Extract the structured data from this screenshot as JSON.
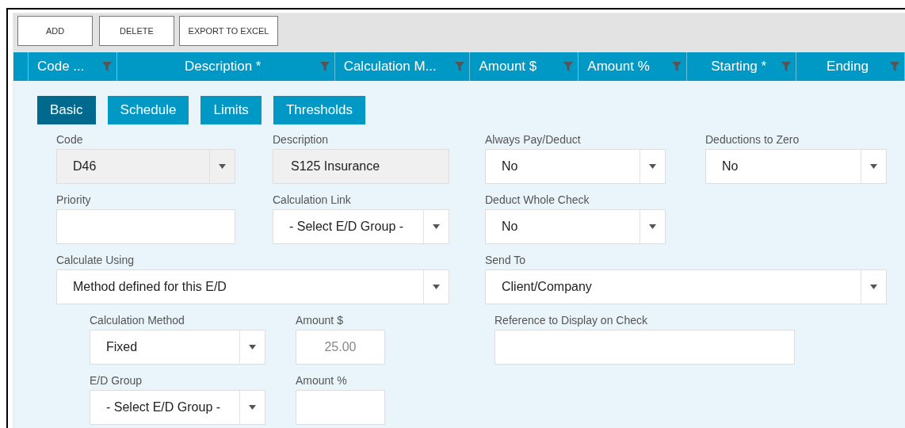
{
  "toolbar": {
    "buttons": [
      "ADD",
      "DELETE",
      "EXPORT TO EXCEL"
    ]
  },
  "table": {
    "columns": [
      {
        "label": "Code ..."
      },
      {
        "label": "Description *"
      },
      {
        "label": "Calculation M..."
      },
      {
        "label": "Amount $"
      },
      {
        "label": "Amount %"
      },
      {
        "label": "Starting *"
      },
      {
        "label": "Ending"
      }
    ]
  },
  "tabs": [
    {
      "label": "Basic",
      "selected": true
    },
    {
      "label": "Schedule",
      "selected": false
    },
    {
      "label": "Limits",
      "selected": false
    },
    {
      "label": "Thresholds",
      "selected": false
    }
  ],
  "form": {
    "left": [
      [
        {
          "label": "Code",
          "kind": "select",
          "value": "D46",
          "disabled": true
        },
        {
          "label": "Description",
          "kind": "text",
          "value": "S125 Insurance",
          "disabled": true
        }
      ],
      [
        {
          "label": "Priority",
          "kind": "text",
          "disabled": false
        },
        {
          "label": "Calculation Link",
          "kind": "select",
          "value": "- Select E/D Group -",
          "disabled": false
        }
      ],
      [
        {
          "label": "Calculate Using",
          "kind": "select",
          "value": "Method defined for this E/D",
          "disabled": false
        }
      ]
    ],
    "right": [
      [
        {
          "label": "Always Pay/Deduct",
          "kind": "select",
          "value": "No",
          "disabled": false
        },
        {
          "label": "Deductions to Zero",
          "kind": "select",
          "value": "No",
          "disabled": false
        }
      ],
      [
        {
          "label": "Deduct Whole Check",
          "kind": "select",
          "value": "No",
          "disabled": false
        }
      ],
      [
        {
          "label": "Send To",
          "kind": "select",
          "value": "Client/Company",
          "disabled": false
        }
      ]
    ]
  },
  "method": {
    "left": [
      [
        {
          "label": "Calculation Method",
          "kind": "select",
          "value": "Fixed",
          "disabled": false
        },
        {
          "label": "Amount $",
          "kind": "text",
          "placeholder": "25.00",
          "disabled": false
        }
      ],
      [
        {
          "label": "E/D Group",
          "kind": "select",
          "value": "- Select E/D Group -",
          "disabled": false
        },
        {
          "label": "Amount %",
          "kind": "text",
          "disabled": false
        }
      ]
    ],
    "right": [
      [
        {
          "label": "Reference to Display on Check",
          "kind": "text",
          "disabled": false
        }
      ]
    ]
  }
}
